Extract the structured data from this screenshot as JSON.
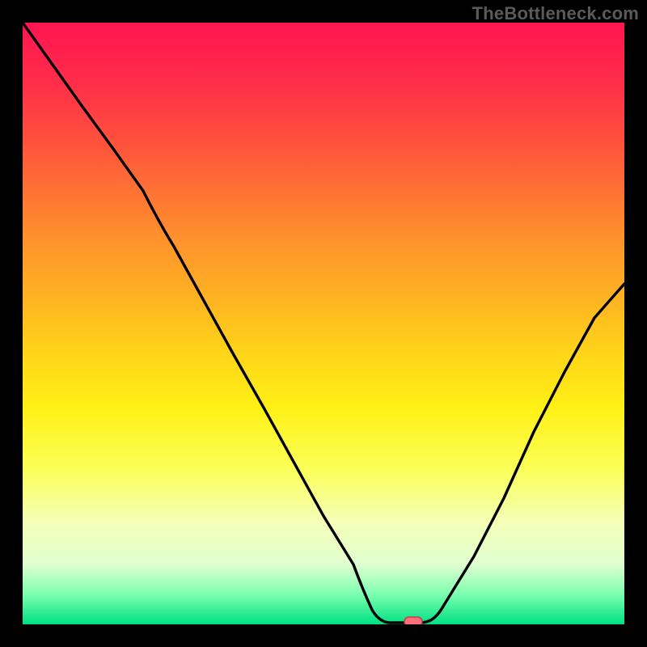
{
  "watermark": "TheBottleneck.com",
  "marker": {
    "fill": "#ff6f7a",
    "stroke": "#cc3a4a"
  },
  "curve_stroke": "#000000",
  "chart_data": {
    "type": "line",
    "title": "",
    "xlabel": "",
    "ylabel": "",
    "x": [
      0.0,
      0.05,
      0.1,
      0.15,
      0.2,
      0.25,
      0.3,
      0.35,
      0.4,
      0.45,
      0.5,
      0.55,
      0.58,
      0.61,
      0.64,
      0.66,
      0.7,
      0.75,
      0.8,
      0.85,
      0.9,
      0.95,
      1.0
    ],
    "values": [
      1.0,
      0.93,
      0.86,
      0.79,
      0.72,
      0.63,
      0.54,
      0.45,
      0.36,
      0.27,
      0.18,
      0.1,
      0.05,
      0.01,
      0.0,
      0.0,
      0.03,
      0.11,
      0.21,
      0.32,
      0.42,
      0.51,
      0.56
    ],
    "marker_point": {
      "x": 0.65,
      "y": 0.0
    },
    "xlim": [
      0,
      1
    ],
    "ylim": [
      0,
      1
    ],
    "notes": "Curve descends from top-left, flattens at the bottom near x≈0.63–0.67 (marker), then rises toward the right edge reaching ≈0.56 at x=1."
  }
}
